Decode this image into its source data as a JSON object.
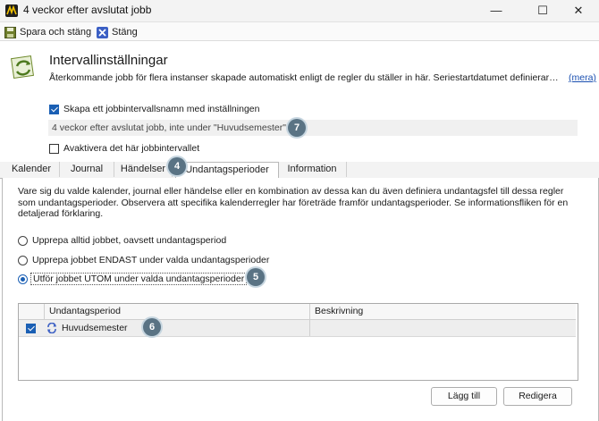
{
  "window": {
    "title": "4 veckor efter avslutat jobb",
    "minimize_glyph": "—",
    "maximize_glyph": "☐",
    "close_glyph": "✕"
  },
  "toolbar": {
    "save_close_label": "Spara och stäng",
    "close_label": "Stäng"
  },
  "header": {
    "title": "Intervallinställningar",
    "description": "Återkommande jobb för flera instanser skapade automatiskt enligt de regler du ställer in här. Seriestartdatumet definierar fr...",
    "more_link": "(mera)"
  },
  "settings": {
    "create_name_label": "Skapa ett jobbintervallsnamn med inställningen",
    "create_name_checked": true,
    "name_value": "4 veckor efter avslutat jobb, inte under \"Huvudsemester\"",
    "deactivate_label": "Avaktivera det här jobbintervallet",
    "deactivate_checked": false
  },
  "badges": {
    "b4": "4",
    "b5": "5",
    "b6": "6",
    "b7": "7"
  },
  "tabs": [
    {
      "label": "Kalender",
      "active": false
    },
    {
      "label": "Journal",
      "active": false
    },
    {
      "label": "Händelser",
      "active": false
    },
    {
      "label": "Undantagsperioder",
      "active": true
    },
    {
      "label": "Information",
      "active": false
    }
  ],
  "exceptions": {
    "description": "Vare sig du valde kalender, journal eller händelse eller en kombination av dessa kan du även definiera undantagsfel till dessa regler som undantagsperioder. Observera att specifika kalenderregler har företräde framför undantagsperioder. Se informationsfliken för en detaljerad förklaring.",
    "options": [
      {
        "label": "Upprepa alltid jobbet, oavsett undantagsperiod",
        "selected": false
      },
      {
        "label": "Upprepa jobbet ENDAST under valda undantagsperioder",
        "selected": false
      },
      {
        "label": "Utför jobbet UTOM under valda undantagsperioder",
        "selected": true
      }
    ],
    "table": {
      "columns": [
        "Undantagsperiod",
        "Beskrivning"
      ],
      "rows": [
        {
          "checked": true,
          "period": "Huvudsemester",
          "description": ""
        }
      ]
    },
    "add_button": "Lägg till",
    "edit_button": "Redigera"
  },
  "colors": {
    "accent": "#1a5fb4",
    "badge": "#5a7384"
  }
}
